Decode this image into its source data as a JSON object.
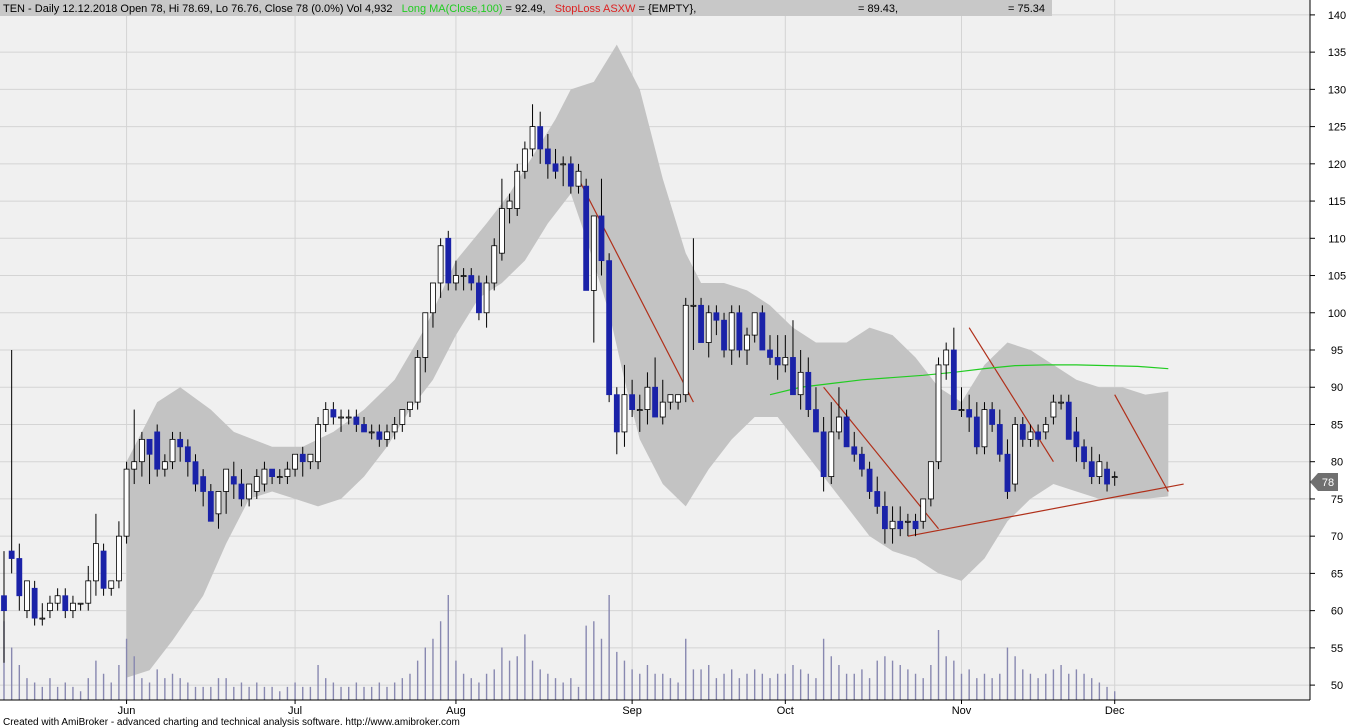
{
  "header": {
    "ohlc_text": "TEN - Daily 12.12.2018 Open 78, Hi 78.69, Lo 76.76, Close 78 (0.0%) Vol 4,932",
    "ma_text": "Long MA(Close,100)",
    "ma_value": " = 92.49,",
    "stop_text": "StopLoss ASXW",
    "stop_value": " = {EMPTY},",
    "band_upper": "= 89.43,",
    "band_lower": "= 75.34"
  },
  "footer": {
    "credit": "Created with AmiBroker - advanced charting and technical analysis software. http://www.amibroker.com"
  },
  "last_price_label": "78",
  "colors": {
    "up_candle": "#ffffff",
    "down_candle": "#1a22a8",
    "band": "#c3c3c3",
    "ma_line": "#22cc22",
    "trend_line": "#b0301a",
    "volume": "#8888b0",
    "background": "#f0f0f0",
    "grid": "#d4d4d4"
  },
  "chart_data": {
    "type": "candlestick",
    "symbol": "TEN",
    "ylim": [
      48,
      142
    ],
    "y_ticks": [
      50,
      55,
      60,
      65,
      70,
      75,
      80,
      85,
      90,
      95,
      100,
      105,
      110,
      115,
      120,
      125,
      130,
      135,
      140
    ],
    "x_tick_labels": [
      {
        "label": "Jun",
        "bar": 16
      },
      {
        "label": "Jul",
        "bar": 38
      },
      {
        "label": "Aug",
        "bar": 59
      },
      {
        "label": "Sep",
        "bar": 82
      },
      {
        "label": "Oct",
        "bar": 102
      },
      {
        "label": "Nov",
        "bar": 125
      },
      {
        "label": "Dec",
        "bar": 145
      }
    ],
    "candles": [
      [
        62,
        68,
        53,
        60,
        18
      ],
      [
        68,
        95,
        65,
        67,
        12
      ],
      [
        67,
        69,
        60,
        62,
        8
      ],
      [
        60,
        64,
        59,
        64,
        5
      ],
      [
        63,
        64,
        58,
        59,
        4
      ],
      [
        59,
        61,
        58,
        59,
        3
      ],
      [
        60,
        62,
        59,
        61,
        5
      ],
      [
        61,
        63,
        60,
        62,
        3
      ],
      [
        62,
        63,
        59,
        60,
        4
      ],
      [
        60,
        62,
        59,
        61,
        3
      ],
      [
        61,
        61,
        60,
        61,
        2
      ],
      [
        61,
        66,
        60,
        64,
        5
      ],
      [
        64,
        73,
        62,
        69,
        9
      ],
      [
        68,
        69,
        62,
        63,
        6
      ],
      [
        63,
        64,
        62,
        64,
        4
      ],
      [
        64,
        72,
        63,
        70,
        8
      ],
      [
        70,
        80,
        69,
        79,
        14
      ],
      [
        79,
        87,
        77,
        80,
        10
      ],
      [
        80,
        84,
        78,
        83,
        5
      ],
      [
        83,
        83,
        77,
        81,
        4
      ],
      [
        84,
        85,
        78,
        79,
        7
      ],
      [
        79,
        81,
        78,
        80,
        5
      ],
      [
        80,
        84,
        79,
        83,
        6
      ],
      [
        83,
        84,
        80,
        82,
        5
      ],
      [
        82,
        83,
        78,
        80,
        4
      ],
      [
        80,
        81,
        76,
        77,
        3
      ],
      [
        78,
        79,
        74,
        76,
        3
      ],
      [
        76,
        77,
        72,
        72,
        3
      ],
      [
        73,
        76,
        71,
        76,
        5
      ],
      [
        76,
        79,
        73,
        79,
        5
      ],
      [
        78,
        80,
        75,
        77,
        3
      ],
      [
        77,
        79,
        74,
        75,
        4
      ],
      [
        75,
        77,
        74,
        77,
        3
      ],
      [
        76,
        79,
        75,
        78,
        4
      ],
      [
        77,
        80,
        76,
        79,
        3
      ],
      [
        79,
        79,
        77,
        78,
        3
      ],
      [
        78,
        79,
        77,
        78,
        2
      ],
      [
        78,
        80,
        77,
        79,
        3
      ],
      [
        79,
        81,
        78,
        81,
        4
      ],
      [
        81,
        82,
        78,
        80,
        3
      ],
      [
        80,
        81,
        79,
        81,
        3
      ],
      [
        80,
        86,
        79,
        85,
        8
      ],
      [
        85,
        88,
        84,
        87,
        5
      ],
      [
        87,
        88,
        85,
        86,
        4
      ],
      [
        86,
        87,
        84,
        86,
        3
      ],
      [
        86,
        87,
        85,
        86,
        3
      ],
      [
        86,
        87,
        84,
        85,
        4
      ],
      [
        85,
        86,
        84,
        84,
        3
      ],
      [
        84,
        85,
        83,
        84,
        3
      ],
      [
        84,
        85,
        82,
        83,
        4
      ],
      [
        83,
        85,
        82,
        84,
        3
      ],
      [
        84,
        86,
        83,
        85,
        4
      ],
      [
        85,
        87,
        84,
        87,
        5
      ],
      [
        87,
        88,
        86,
        88,
        6
      ],
      [
        88,
        95,
        87,
        94,
        9
      ],
      [
        94,
        100,
        92,
        100,
        12
      ],
      [
        100,
        104,
        98,
        104,
        14
      ],
      [
        104,
        110,
        102,
        109,
        18
      ],
      [
        110,
        111,
        103,
        104,
        24
      ],
      [
        104,
        107,
        103,
        105,
        9
      ],
      [
        105,
        106,
        103,
        105,
        6
      ],
      [
        105,
        106,
        103,
        104,
        5
      ],
      [
        104,
        105,
        99,
        100,
        4
      ],
      [
        100,
        105,
        98,
        104,
        6
      ],
      [
        104,
        110,
        103,
        109,
        7
      ],
      [
        108,
        118,
        107,
        114,
        12
      ],
      [
        114,
        116,
        112,
        115,
        9
      ],
      [
        114,
        120,
        113,
        119,
        10
      ],
      [
        119,
        123,
        118,
        122,
        15
      ],
      [
        122,
        128,
        121,
        125,
        9
      ],
      [
        125,
        127,
        120,
        122,
        7
      ],
      [
        122,
        124,
        118,
        120,
        6
      ],
      [
        120,
        122,
        118,
        119,
        5
      ],
      [
        120,
        121,
        117,
        120,
        4
      ],
      [
        120,
        121,
        116,
        117,
        5
      ],
      [
        117,
        120,
        116,
        119,
        3
      ],
      [
        117,
        118,
        103,
        103,
        17
      ],
      [
        103,
        112,
        96,
        113,
        18
      ],
      [
        113,
        118,
        105,
        107,
        14
      ],
      [
        107,
        108,
        88,
        89,
        24
      ],
      [
        89,
        90,
        81,
        84,
        11
      ],
      [
        84,
        93,
        82,
        89,
        9
      ],
      [
        89,
        91,
        86,
        87,
        7
      ],
      [
        87,
        89,
        84,
        87,
        6
      ],
      [
        87,
        92,
        85,
        90,
        8
      ],
      [
        90,
        94,
        86,
        86,
        6
      ],
      [
        86,
        91,
        85,
        88,
        6
      ],
      [
        88,
        89,
        87,
        89,
        5
      ],
      [
        88,
        89,
        87,
        89,
        4
      ],
      [
        89,
        102,
        88,
        101,
        14
      ],
      [
        101,
        110,
        95,
        101,
        7
      ],
      [
        101,
        102,
        96,
        96,
        7
      ],
      [
        96,
        101,
        94,
        100,
        8
      ],
      [
        100,
        101,
        97,
        99,
        5
      ],
      [
        99,
        100,
        94,
        95,
        6
      ],
      [
        95,
        101,
        93,
        100,
        7
      ],
      [
        100,
        101,
        94,
        95,
        5
      ],
      [
        95,
        98,
        93,
        97,
        6
      ],
      [
        97,
        100,
        96,
        100,
        7
      ],
      [
        100,
        101,
        95,
        95,
        6
      ],
      [
        95,
        97,
        93,
        94,
        5
      ],
      [
        94,
        97,
        91,
        93,
        6
      ],
      [
        93,
        97,
        92,
        94,
        6
      ],
      [
        94,
        99,
        89,
        89,
        8
      ],
      [
        89,
        95,
        87,
        92,
        7
      ],
      [
        92,
        94,
        86,
        87,
        6
      ],
      [
        87,
        90,
        85,
        84,
        5
      ],
      [
        84,
        86,
        76,
        78,
        14
      ],
      [
        78,
        88,
        77,
        84,
        10
      ],
      [
        84,
        90,
        83,
        86,
        8
      ],
      [
        86,
        87,
        82,
        82,
        6
      ],
      [
        82,
        84,
        80,
        81,
        6
      ],
      [
        81,
        82,
        78,
        79,
        7
      ],
      [
        79,
        80,
        75,
        76,
        5
      ],
      [
        76,
        78,
        73,
        74,
        9
      ],
      [
        74,
        76,
        69,
        71,
        10
      ],
      [
        71,
        74,
        69,
        72,
        9
      ],
      [
        72,
        74,
        70,
        71,
        8
      ],
      [
        72,
        73,
        70,
        72,
        7
      ],
      [
        72,
        73,
        70,
        71,
        6
      ],
      [
        72,
        75,
        71,
        75,
        5
      ],
      [
        75,
        80,
        74,
        80,
        8
      ],
      [
        80,
        94,
        79,
        93,
        16
      ],
      [
        93,
        96,
        91,
        95,
        10
      ],
      [
        95,
        98,
        87,
        87,
        9
      ],
      [
        87,
        90,
        86,
        87,
        6
      ],
      [
        87,
        89,
        84,
        86,
        7
      ],
      [
        86,
        88,
        81,
        82,
        5
      ],
      [
        82,
        88,
        81,
        87,
        6
      ],
      [
        87,
        88,
        84,
        85,
        5
      ],
      [
        85,
        87,
        80,
        81,
        6
      ],
      [
        81,
        83,
        75,
        76,
        12
      ],
      [
        77,
        86,
        76,
        85,
        10
      ],
      [
        85,
        86,
        82,
        83,
        7
      ],
      [
        83,
        85,
        82,
        84,
        6
      ],
      [
        84,
        85,
        82,
        83,
        5
      ],
      [
        84,
        86,
        83,
        85,
        6
      ],
      [
        86,
        89,
        85,
        88,
        7
      ],
      [
        88,
        89,
        87,
        88,
        8
      ],
      [
        88,
        89,
        83,
        83,
        6
      ],
      [
        84,
        86,
        80,
        82,
        7
      ],
      [
        82,
        83,
        79,
        80,
        6
      ],
      [
        80,
        82,
        77,
        78,
        5
      ],
      [
        78,
        81,
        77,
        80,
        4
      ],
      [
        79,
        80,
        76,
        77,
        3
      ],
      [
        78,
        78.69,
        76.76,
        78,
        2
      ]
    ],
    "bollinger_upper": [
      [
        16,
        80
      ],
      [
        20,
        88
      ],
      [
        23,
        90
      ],
      [
        27,
        87
      ],
      [
        30,
        84
      ],
      [
        35,
        82
      ],
      [
        39,
        82
      ],
      [
        43,
        84
      ],
      [
        47,
        87
      ],
      [
        51,
        91
      ],
      [
        55,
        98
      ],
      [
        59,
        107
      ],
      [
        63,
        112
      ],
      [
        66,
        116
      ],
      [
        69,
        121
      ],
      [
        72,
        126
      ],
      [
        74,
        130
      ],
      [
        77,
        131
      ],
      [
        80,
        136
      ],
      [
        83,
        130
      ],
      [
        86,
        118
      ],
      [
        89,
        108
      ],
      [
        91,
        104
      ],
      [
        94,
        104
      ],
      [
        97,
        103
      ],
      [
        100,
        101
      ],
      [
        103,
        98
      ],
      [
        106,
        96
      ],
      [
        110,
        96
      ],
      [
        113,
        98
      ],
      [
        116,
        97
      ],
      [
        119,
        94
      ],
      [
        122,
        90
      ],
      [
        125,
        88
      ],
      [
        128,
        93
      ],
      [
        131,
        96
      ],
      [
        134,
        95
      ],
      [
        137,
        93
      ],
      [
        140,
        91
      ],
      [
        143,
        90
      ],
      [
        146,
        90
      ],
      [
        149,
        89
      ],
      [
        152,
        89.43
      ]
    ],
    "bollinger_lower": [
      [
        16,
        51
      ],
      [
        19,
        52
      ],
      [
        22,
        56
      ],
      [
        26,
        62
      ],
      [
        29,
        69
      ],
      [
        32,
        75
      ],
      [
        35,
        76
      ],
      [
        38,
        75
      ],
      [
        41,
        74
      ],
      [
        44,
        75
      ],
      [
        47,
        78
      ],
      [
        50,
        82
      ],
      [
        53,
        87
      ],
      [
        56,
        91
      ],
      [
        59,
        97
      ],
      [
        62,
        102
      ],
      [
        65,
        104
      ],
      [
        68,
        107
      ],
      [
        71,
        112
      ],
      [
        74,
        116
      ],
      [
        76,
        110
      ],
      [
        79,
        100
      ],
      [
        81,
        91
      ],
      [
        83,
        83
      ],
      [
        86,
        77
      ],
      [
        89,
        74
      ],
      [
        92,
        79
      ],
      [
        95,
        83
      ],
      [
        98,
        86
      ],
      [
        101,
        86
      ],
      [
        104,
        82
      ],
      [
        107,
        78
      ],
      [
        110,
        74
      ],
      [
        113,
        70
      ],
      [
        116,
        68
      ],
      [
        119,
        67
      ],
      [
        122,
        65
      ],
      [
        125,
        64
      ],
      [
        128,
        67
      ],
      [
        131,
        72
      ],
      [
        134,
        75
      ],
      [
        137,
        77
      ],
      [
        140,
        76
      ],
      [
        143,
        75
      ],
      [
        146,
        75
      ],
      [
        149,
        75
      ],
      [
        152,
        75.34
      ]
    ],
    "ma_line": [
      [
        100,
        89
      ],
      [
        104,
        90
      ],
      [
        108,
        90.5
      ],
      [
        112,
        91
      ],
      [
        116,
        91.3
      ],
      [
        120,
        91.6
      ],
      [
        124,
        92
      ],
      [
        128,
        92.5
      ],
      [
        132,
        92.9
      ],
      [
        136,
        93
      ],
      [
        140,
        93
      ],
      [
        144,
        92.9
      ],
      [
        148,
        92.8
      ],
      [
        152,
        92.49
      ]
    ],
    "trend_lines": [
      [
        [
          75,
          118
        ],
        [
          90,
          88
        ]
      ],
      [
        [
          107,
          90
        ],
        [
          122,
          71
        ]
      ],
      [
        [
          118,
          70
        ],
        [
          154,
          77
        ]
      ],
      [
        [
          126,
          98
        ],
        [
          137,
          80
        ]
      ],
      [
        [
          145,
          89
        ],
        [
          152,
          76
        ]
      ]
    ]
  }
}
